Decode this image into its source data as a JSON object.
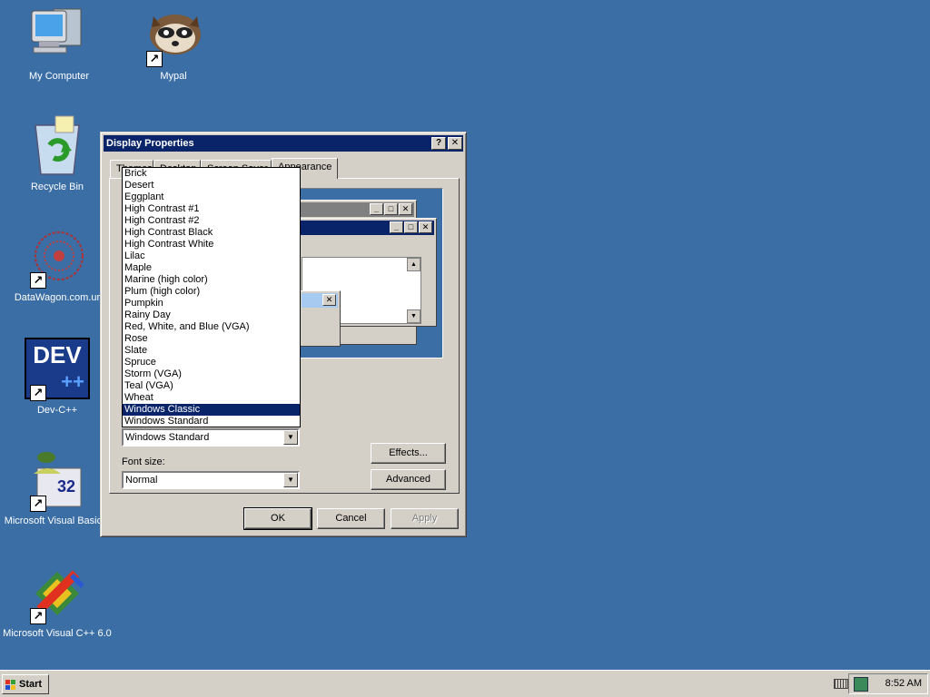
{
  "desktop": {
    "icons": [
      {
        "label": "My Computer"
      },
      {
        "label": "Mypal"
      },
      {
        "label": "Recycle Bin"
      },
      {
        "label": "DataWagon.com.ur"
      },
      {
        "label": "Dev-C++"
      },
      {
        "label": "Microsoft Visual Basic 6"
      },
      {
        "label": "Microsoft Visual C++ 6.0"
      }
    ],
    "dev_icon_text": "DEV",
    "vb_icon_text": "32"
  },
  "dialog": {
    "title": "Display Properties",
    "help_button": "?",
    "close_button": "✕",
    "tabs": [
      {
        "label": "Themes"
      },
      {
        "label": "Desktop"
      },
      {
        "label": "Screen Saver"
      },
      {
        "label": "Appearance"
      }
    ],
    "scheme_dropdown": {
      "options": [
        "Brick",
        "Desert",
        "Eggplant",
        "High Contrast #1",
        "High Contrast #2",
        "High Contrast Black",
        "High Contrast White",
        "Lilac",
        "Maple",
        "Marine (high color)",
        "Plum (high color)",
        "Pumpkin",
        "Rainy Day",
        "Red, White, and Blue (VGA)",
        "Rose",
        "Slate",
        "Spruce",
        "Storm (VGA)",
        "Teal (VGA)",
        "Wheat",
        "Windows Classic",
        "Windows Standard"
      ],
      "highlighted": "Windows Classic"
    },
    "color_scheme_value": "Windows Standard",
    "font_size_label": "Font size:",
    "font_size_value": "Normal",
    "effects_button": "Effects...",
    "advanced_button": "Advanced",
    "ok_button": "OK",
    "cancel_button": "Cancel",
    "apply_button": "Apply"
  },
  "taskbar": {
    "start_label": "Start",
    "clock": "8:52 AM"
  },
  "colors": {
    "desktop": "#3a6ea5",
    "titlebar_active": "#0a246a",
    "face": "#d4d0c8"
  }
}
